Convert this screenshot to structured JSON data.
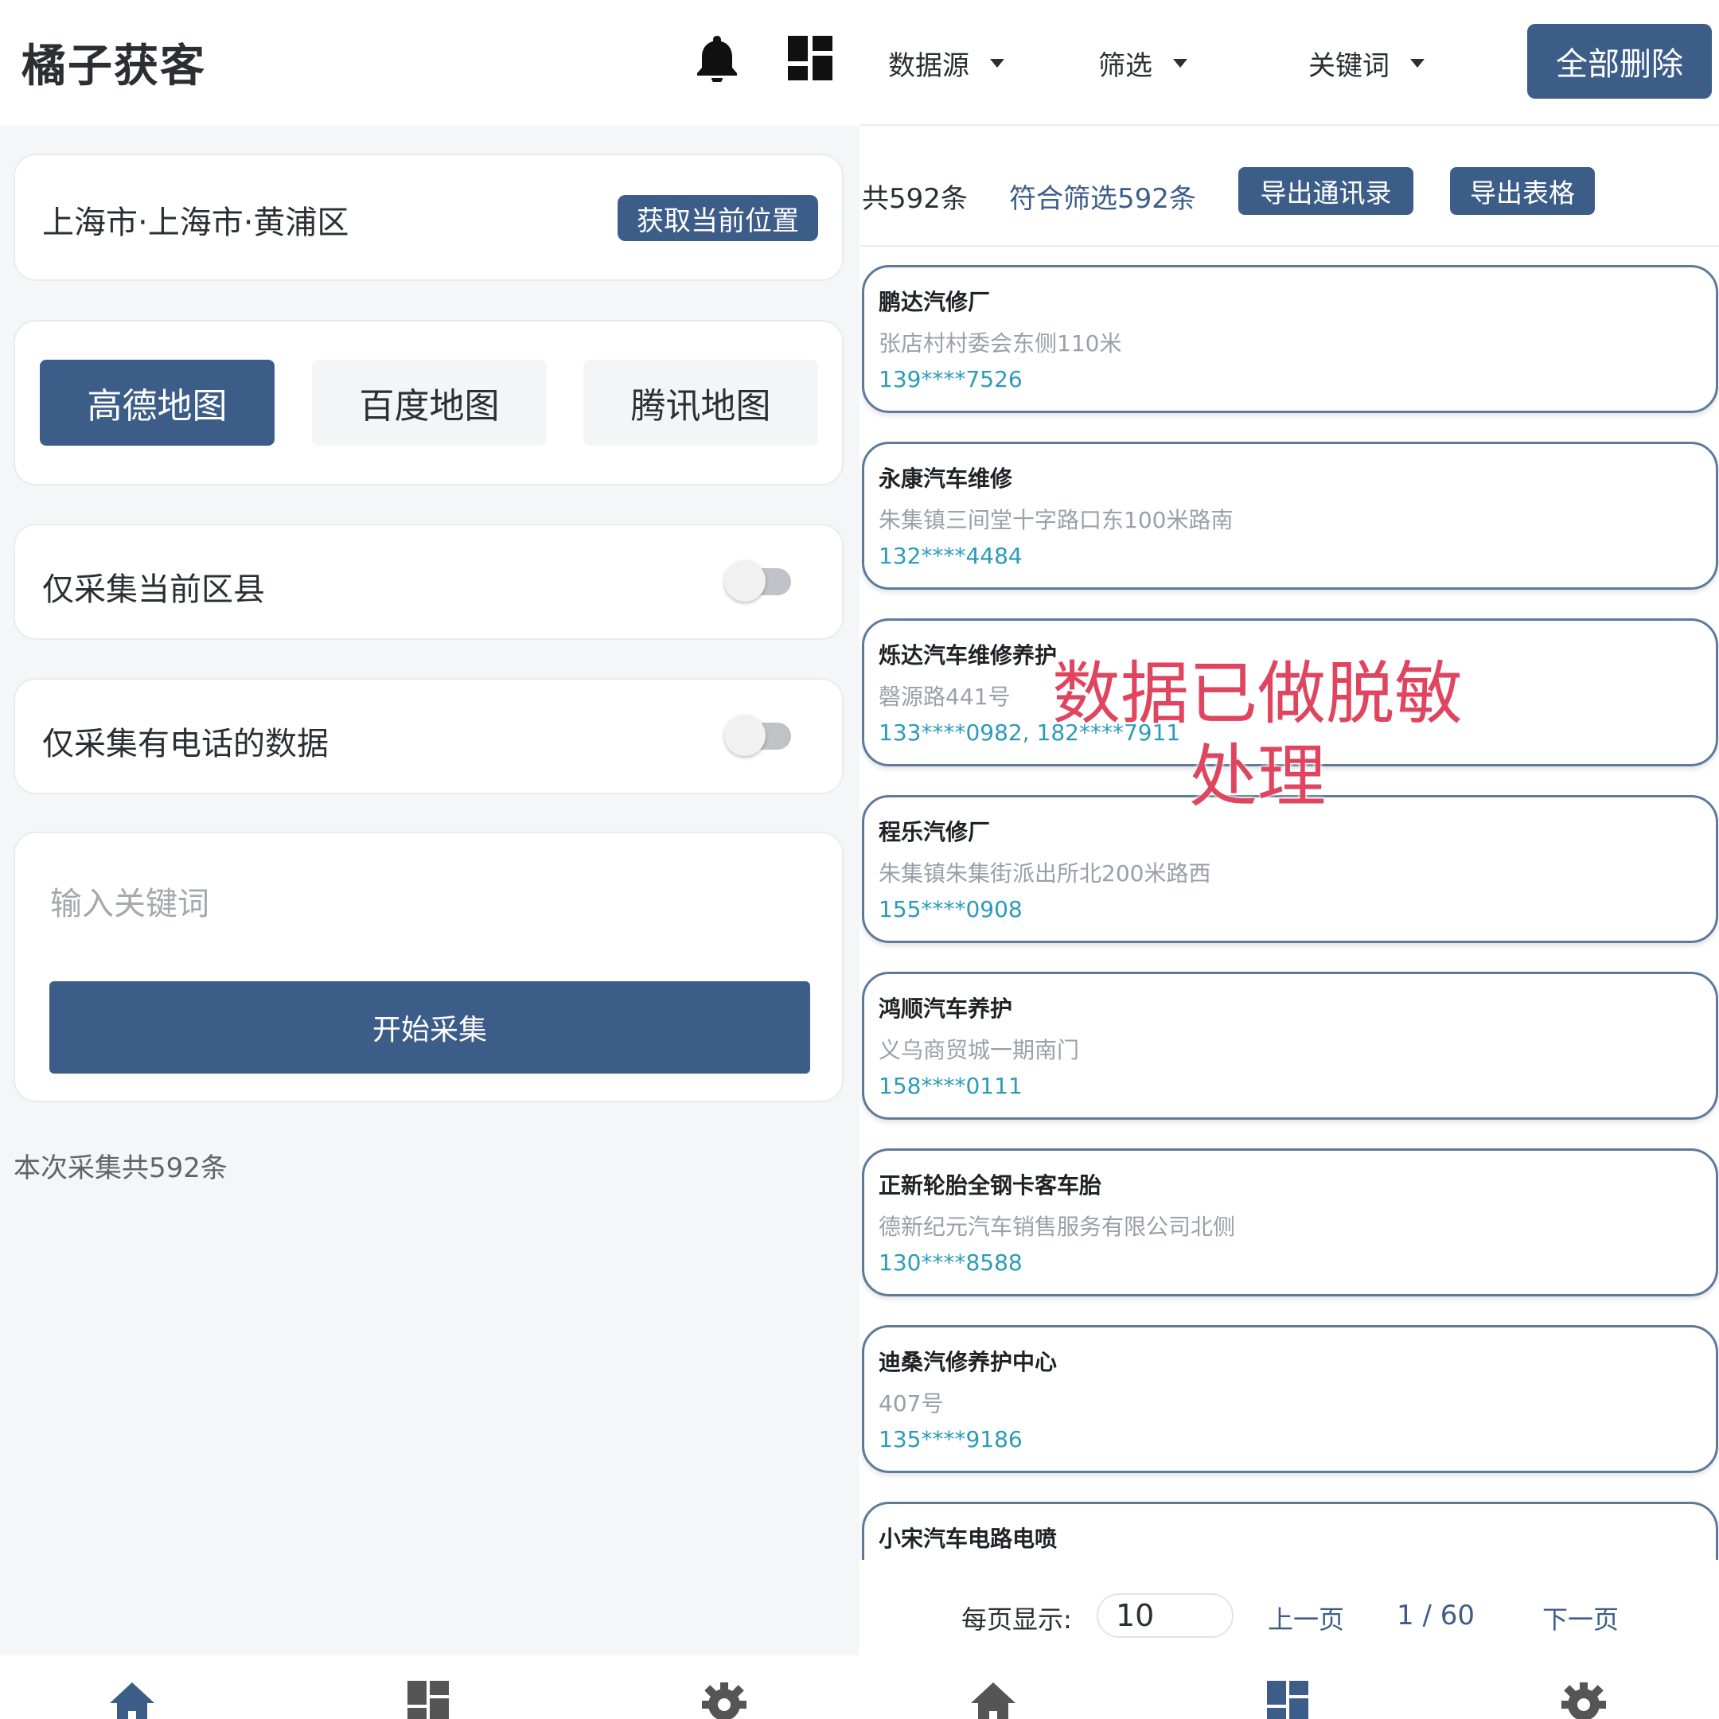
{
  "left": {
    "app_title": "橘子获客",
    "header_icons": [
      "bell-icon",
      "dashboard-icon"
    ],
    "location": {
      "text": "上海市·上海市·黄浦区",
      "button": "获取当前位置"
    },
    "map_sources": [
      {
        "label": "高德地图",
        "selected": true
      },
      {
        "label": "百度地图",
        "selected": false
      },
      {
        "label": "腾讯地图",
        "selected": false
      }
    ],
    "toggles": [
      {
        "label": "仅采集当前区县",
        "on": false
      },
      {
        "label": "仅采集有电话的数据",
        "on": false
      }
    ],
    "keyword": {
      "value": "",
      "placeholder": "输入关键词",
      "start_button": "开始采集"
    },
    "summary": "本次采集共592条",
    "nav_icons": [
      "home-icon",
      "dashboard-icon",
      "gear-icon"
    ]
  },
  "right": {
    "filters": {
      "data_source": "数据源",
      "filter": "筛选",
      "keyword": "关键词",
      "delete_all": "全部删除"
    },
    "counts": {
      "total": "共592条",
      "matched": "符合筛选592条",
      "export_contacts": "导出通讯录",
      "export_table": "导出表格"
    },
    "items": [
      {
        "name": "鹏达汽修厂",
        "address": "张店村村委会东侧110米",
        "phone": "139****7526"
      },
      {
        "name": "永康汽车维修",
        "address": "朱集镇三间堂十字路口东100米路南",
        "phone": "132****4484"
      },
      {
        "name": "烁达汽车维修养护",
        "address": "磬源路441号",
        "phone": "133****0982, 182****7911"
      },
      {
        "name": "程乐汽修厂",
        "address": "朱集镇朱集街派出所北200米路西",
        "phone": "155****0908"
      },
      {
        "name": "鸿顺汽车养护",
        "address": "义乌商贸城一期南门",
        "phone": "158****0111"
      },
      {
        "name": "正新轮胎全钢卡客车胎",
        "address": "德新纪元汽车销售服务有限公司北侧",
        "phone": "130****8588"
      },
      {
        "name": "迪桑汽修养护中心",
        "address": "407号",
        "phone": "135****9186"
      },
      {
        "name": "小宋汽车电路电喷",
        "address": "",
        "phone": ""
      }
    ],
    "watermark": "数据已做脱敏处理",
    "pager": {
      "per_page_label": "每页显示:",
      "per_page_value": "10",
      "prev": "上一页",
      "page_indicator": "1 / 60",
      "next": "下一页"
    },
    "nav_icons": [
      "home-icon",
      "dashboard-icon",
      "gear-icon"
    ]
  },
  "colors": {
    "primary": "#3d5d89",
    "phone": "#2a9bb8",
    "watermark": "#e0455f"
  }
}
